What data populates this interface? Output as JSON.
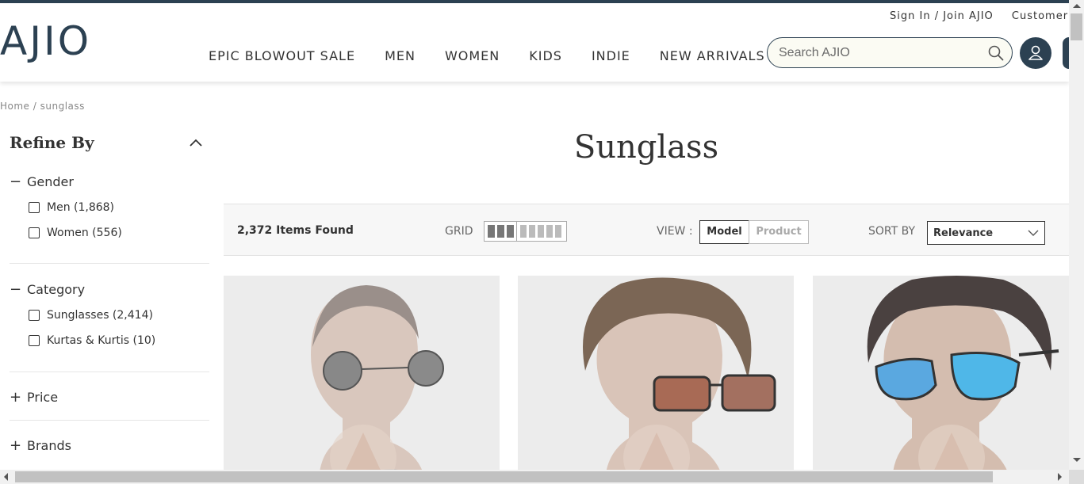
{
  "header": {
    "logo": "AJIO",
    "util_links": [
      "Sign In / Join AJIO",
      "Customer"
    ],
    "nav": [
      "EPIC BLOWOUT SALE",
      "MEN",
      "WOMEN",
      "KIDS",
      "INDIE",
      "NEW ARRIVALS"
    ],
    "search_placeholder": "Search AJIO",
    "search_icon": "search-icon",
    "user_icon": "user-icon"
  },
  "breadcrumb": "Home  /  sunglass",
  "sidebar": {
    "title": "Refine By",
    "groups": [
      {
        "sign": "−",
        "label": "Gender",
        "options": [
          "Men (1,868)",
          "Women (556)"
        ]
      },
      {
        "sign": "−",
        "label": "Category",
        "options": [
          "Sunglasses (2,414)",
          "Kurtas & Kurtis (10)"
        ]
      },
      {
        "sign": "+",
        "label": "Price",
        "options": []
      },
      {
        "sign": "+",
        "label": "Brands",
        "options": []
      }
    ]
  },
  "main": {
    "title": "Sunglass",
    "items_found": "2,372 Items Found",
    "grid_label": "GRID",
    "view_label": "VIEW :",
    "view_model": "Model",
    "view_product": "Product",
    "sort_label": "SORT BY",
    "sort_value": "Relevance"
  },
  "colors": {
    "brand": "#2c4152",
    "toolbar_bg": "#f7f7f7",
    "product_bg": "#ececec"
  }
}
